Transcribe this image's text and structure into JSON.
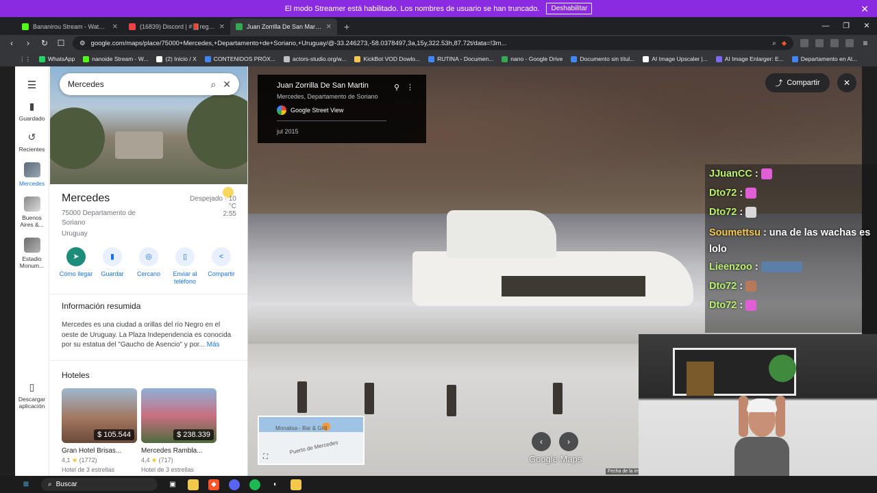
{
  "banner": {
    "message": "El modo Streamer está habilitado. Los nombres de usuario se han truncado.",
    "button_label": "Deshabilitar"
  },
  "tabs": [
    {
      "label": "Bananirou Stream - Watch Live o",
      "color": "#53fc18"
    },
    {
      "label": "(16839) Discord | #📕reglas | banani",
      "color": "#ed4245"
    },
    {
      "label": "Juan Zorrilla De San Martin - Go",
      "color": "#34a853",
      "active": true
    }
  ],
  "address": {
    "url": "google.com/maps/place/75000+Mercedes,+Departamento+de+Soriano,+Uruguay/@-33.246273,-58.0378497,3a,15y,322.53h,87.72t/data=!3m..."
  },
  "bookmarks": [
    {
      "label": "WhatsApp",
      "color": "#25d366"
    },
    {
      "label": "nanoide Stream - W...",
      "color": "#53fc18"
    },
    {
      "label": "(2) Inicio / X",
      "color": "#ffffff"
    },
    {
      "label": "CONTENIDOS PRÓX...",
      "color": "#4285f4"
    },
    {
      "label": "actors-studio.org/w...",
      "color": "#bdc1c6"
    },
    {
      "label": "KickBot VOD Dowlo...",
      "color": "#f2c94c"
    },
    {
      "label": "RUTINA - Documen...",
      "color": "#4285f4"
    },
    {
      "label": "nano - Google Drive",
      "color": "#34a853"
    },
    {
      "label": "Documento sin títul...",
      "color": "#4285f4"
    },
    {
      "label": "AI Image Upscaler |...",
      "color": "#ffffff"
    },
    {
      "label": "AI Image Enlarger: E...",
      "color": "#7b68ee"
    },
    {
      "label": "Departamento en Al...",
      "color": "#4285f4"
    }
  ],
  "rail": {
    "saved": "Guardado",
    "recent": "Recientes",
    "mercedes": "Mercedes",
    "buenos_aires": "Buenos Aires &...",
    "estadio": "Estadio Monum...",
    "download": "Descargar aplicación"
  },
  "search": {
    "value": "Mercedes"
  },
  "place": {
    "title": "Mercedes",
    "address": "75000 Departamento de Soriano",
    "country": "Uruguay",
    "weather_desc": "Despejado · 10 °C",
    "time": "2:55"
  },
  "actions": [
    {
      "label": "Cómo llegar",
      "icon": "directions-icon",
      "glyph": "➤"
    },
    {
      "label": "Guardar",
      "icon": "bookmark-icon",
      "glyph": "▮"
    },
    {
      "label": "Cercano",
      "icon": "nearby-icon",
      "glyph": "◎"
    },
    {
      "label": "Enviar al teléfono",
      "icon": "phone-icon",
      "glyph": "▯"
    },
    {
      "label": "Compartir",
      "icon": "share-icon",
      "glyph": "<"
    }
  ],
  "summary": {
    "title": "Información resumida",
    "text": "Mercedes es una ciudad a orillas del río Negro en el oeste de Uruguay. La Plaza Independencia es conocida por su estatua del \"Gaucho de Asencio\" y por...",
    "more": "Más"
  },
  "hotels": {
    "title": "Hoteles",
    "items": [
      {
        "name": "Gran Hotel Brisas...",
        "price": "$ 105.544",
        "rating": "4,1",
        "reviews": "(1772)",
        "type": "Hotel de 3 estrellas"
      },
      {
        "name": "Mercedes Rambla...",
        "price": "$ 238.339",
        "rating": "4,4",
        "reviews": "(717)",
        "type": "Hotel de 3 estrellas"
      }
    ]
  },
  "streetview": {
    "title": "Juan Zorrilla De San Martin",
    "subtitle": "Mercedes, Departamento de Soriano",
    "brand": "Google Street View",
    "date": "jul 2015",
    "share_label": "Compartir",
    "minimap_label1": "Monalisa - Bar & Grill",
    "minimap_label2": "Puerto de Mercedes",
    "logo": "Google Maps",
    "image_date": "Fecha de la im"
  },
  "chat": [
    {
      "user": "JJuanCC",
      "text": ":",
      "color": "#b8f26d",
      "emote": "#e05ed6"
    },
    {
      "user": "Dto72",
      "text": ":",
      "color": "#b8f26d",
      "emote": "#e05ed6"
    },
    {
      "user": "Dto72",
      "text": ":",
      "color": "#b8f26d",
      "emote": "#d9d9d9"
    },
    {
      "user": "Soumettsu",
      "text": ": una de las wachas es lolo",
      "color": "#f2c94c"
    },
    {
      "user": "Lieenzoo",
      "text": ":",
      "color": "#b8f26d",
      "emote": "#5b7fa6"
    },
    {
      "user": "Dto72",
      "text": ":",
      "color": "#b8f26d",
      "emote": "#b67a5a"
    },
    {
      "user": "Dto72",
      "text": ":",
      "color": "#b8f26d",
      "emote": "#e05ed6"
    }
  ],
  "taskbar": {
    "search_label": "Buscar"
  }
}
